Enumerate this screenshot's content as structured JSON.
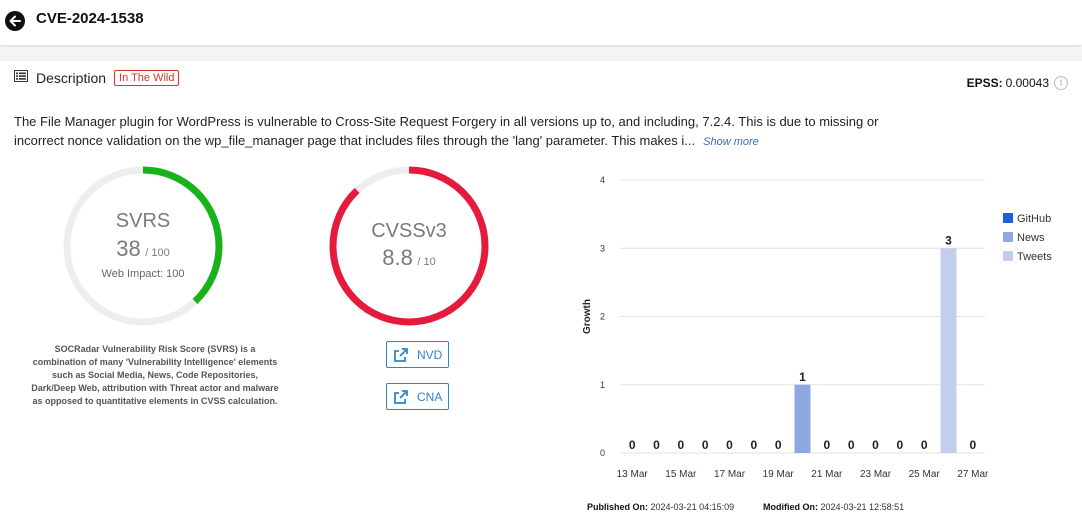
{
  "header": {
    "title": "CVE-2024-1538"
  },
  "description": {
    "label": "Description",
    "badge": "In The Wild",
    "epss_label": "EPSS:",
    "epss_value": "0.00043",
    "text": "The File Manager plugin for WordPress is vulnerable to Cross-Site Request Forgery in all versions up to, and including, 7.2.4. This is due to missing or incorrect nonce validation on the wp_file_manager page that includes files through the 'lang' parameter. This makes i...",
    "show_more": "Show more"
  },
  "svrs": {
    "title": "SVRS",
    "score": "38",
    "max": "/ 100",
    "web_impact": "Web Impact: 100",
    "score_fraction": 0.38,
    "color": "#1ab21a",
    "note": "SOCRadar Vulnerability Risk Score (SVRS) is a combination of many 'Vulnerability Intelligence' elements such as Social Media, News, Code Repositories, Dark/Deep Web, attribution with Threat actor and malware as opposed to quantitative elements in CVSS calculation."
  },
  "cvss": {
    "title": "CVSSv3",
    "score": "8.8",
    "max": "/ 10",
    "score_fraction": 0.88,
    "color": "#e41b3c"
  },
  "links": {
    "nvd": "NVD",
    "cna": "CNA"
  },
  "meta": {
    "published_label": "Published On:",
    "published_value": "2024-03-21 04:15:09",
    "modified_label": "Modified On:",
    "modified_value": "2024-03-21 12:58:51"
  },
  "chart_data": {
    "type": "bar",
    "ylabel": "Growth",
    "ylim": [
      0,
      4
    ],
    "yticks": [
      "0",
      "1",
      "2",
      "3",
      "4"
    ],
    "x_ticks": [
      "13 Mar",
      "15 Mar",
      "17 Mar",
      "19 Mar",
      "21 Mar",
      "23 Mar",
      "25 Mar",
      "27 Mar"
    ],
    "categories": [
      "13 Mar",
      "14 Mar",
      "15 Mar",
      "16 Mar",
      "17 Mar",
      "18 Mar",
      "19 Mar",
      "20 Mar",
      "21 Mar",
      "22 Mar",
      "23 Mar",
      "24 Mar",
      "25 Mar",
      "26 Mar",
      "27 Mar"
    ],
    "totals": [
      0,
      0,
      0,
      0,
      0,
      0,
      0,
      1,
      0,
      0,
      0,
      0,
      0,
      3,
      0
    ],
    "series": [
      {
        "name": "GitHub",
        "color": "#1a5fd6",
        "values": [
          0,
          0,
          0,
          0,
          0,
          0,
          0,
          0,
          0,
          0,
          0,
          0,
          0,
          0,
          0
        ]
      },
      {
        "name": "News",
        "color": "#8ea9df",
        "values": [
          0,
          0,
          0,
          0,
          0,
          0,
          0,
          1,
          0,
          0,
          0,
          0,
          0,
          0,
          0
        ]
      },
      {
        "name": "Tweets",
        "color": "#c1cfec",
        "values": [
          0,
          0,
          0,
          0,
          0,
          0,
          0,
          0,
          0,
          0,
          0,
          0,
          0,
          3,
          0
        ]
      }
    ],
    "legend_position": "right",
    "grid": true
  }
}
